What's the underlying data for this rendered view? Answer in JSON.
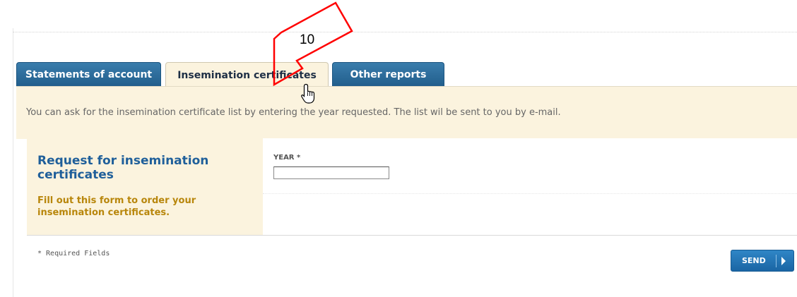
{
  "tabs": [
    {
      "label": "Statements of account",
      "active": false
    },
    {
      "label": "Insemination certificates",
      "active": true
    },
    {
      "label": "Other reports",
      "active": false
    }
  ],
  "info": {
    "text": "You can ask for the insemination certificate list by entering the year requested. The list wil be sent to you by e-mail."
  },
  "form": {
    "title": "Request for insemination certificates",
    "subtitle": "Fill out this form to order your insemination certificates.",
    "year_label": "YEAR *",
    "year_value": "",
    "required_note": "* Required Fields",
    "send_label": "SEND"
  },
  "annotation": {
    "callout_number": "10",
    "arrow_color": "#ff0000",
    "cursor": "hand-pointer-icon"
  },
  "colors": {
    "tab_blue": "#215d8b",
    "panel_cream": "#fbf3de",
    "title_blue": "#1f5f9a",
    "subtitle_gold": "#b8860b",
    "button_blue": "#1a65a4"
  }
}
